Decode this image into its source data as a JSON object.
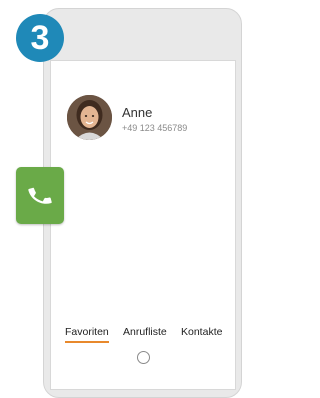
{
  "step": {
    "number": "3"
  },
  "contact": {
    "name": "Anne",
    "number": "+49 123 456789",
    "avatar_icon": "person-avatar"
  },
  "call": {
    "icon": "phone-handset-icon",
    "color": "#6aaa48"
  },
  "tabs": [
    {
      "label": "Favoriten",
      "active": true
    },
    {
      "label": "Anrufliste",
      "active": false
    },
    {
      "label": "Kontakte",
      "active": false
    }
  ],
  "colors": {
    "badge": "#1f89b8",
    "active_tab_underline": "#e8892c"
  }
}
